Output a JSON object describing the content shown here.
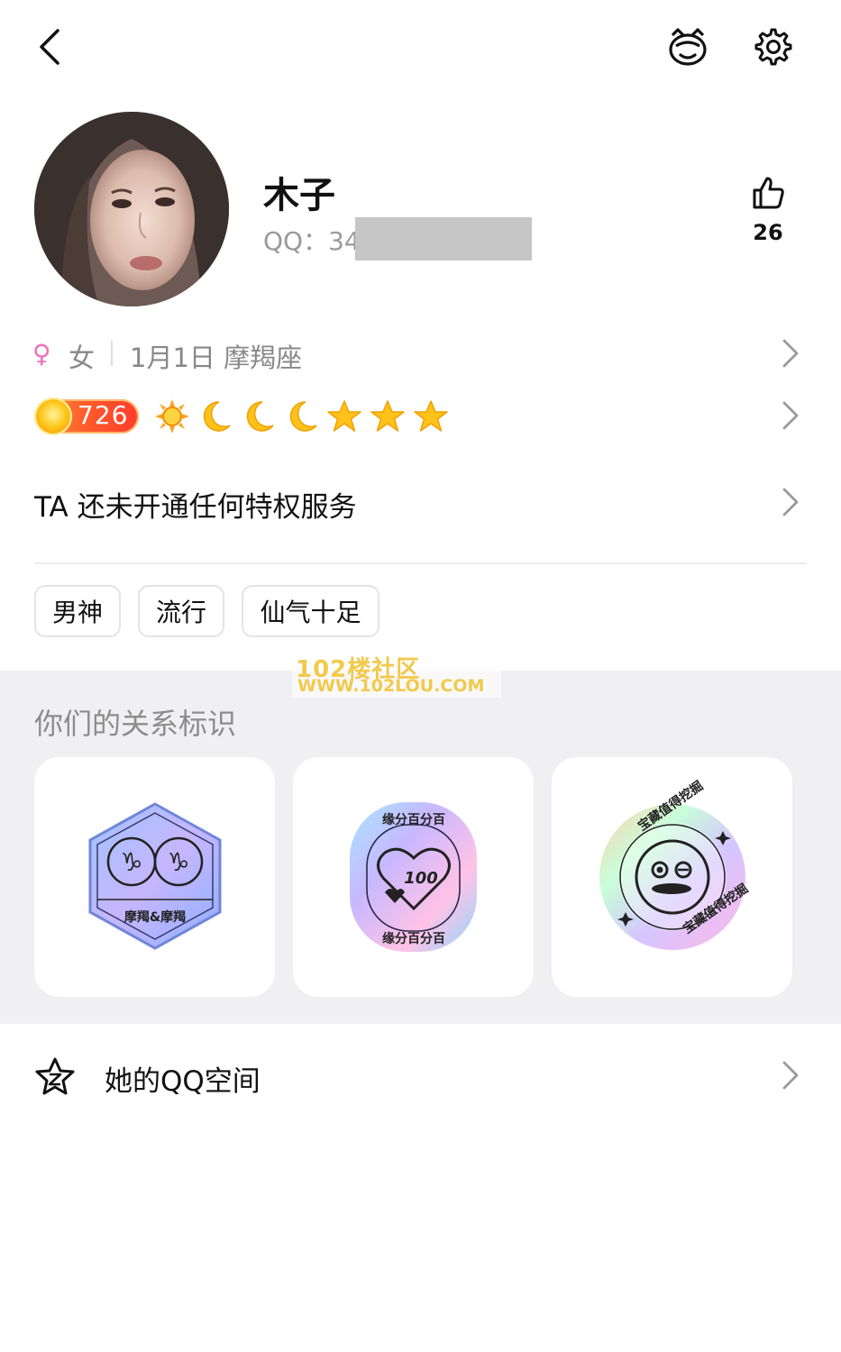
{
  "header": {
    "back_icon": "chevron-left-icon",
    "pet_icon": "pet-face-icon",
    "settings_icon": "gear-icon"
  },
  "profile": {
    "nickname": "木子",
    "qq_label": "QQ：34",
    "likes": "26",
    "like_icon": "thumbs-up-icon"
  },
  "info": {
    "gender_symbol": "♀",
    "gender": "女",
    "birthday": "1月1日  摩羯座"
  },
  "level": {
    "number": "726",
    "badges": [
      "sun",
      "moon",
      "moon",
      "moon",
      "star",
      "star",
      "star"
    ]
  },
  "privilege_text": "TA 还未开通任何特权服务",
  "tags": [
    "男神",
    "流行",
    "仙气十足"
  ],
  "relationship": {
    "title": "你们的关系标识",
    "badges": [
      {
        "name": "capricorn-badge",
        "label": "摩羯&摩羯"
      },
      {
        "name": "fate-100-badge",
        "label": "缘分百分百",
        "number": "100"
      },
      {
        "name": "treasure-badge",
        "label": "宝藏值得挖掘"
      }
    ]
  },
  "watermark": {
    "line1": "102楼社区",
    "line2": "WWW.102LOU.COM"
  },
  "qzone": {
    "label": "她的QQ空间",
    "icon": "qzone-star-icon"
  },
  "colors": {
    "accent_pink": "#f06fb8",
    "level_orange": "#ff5a2b",
    "section_bg": "#f0f0f2"
  }
}
